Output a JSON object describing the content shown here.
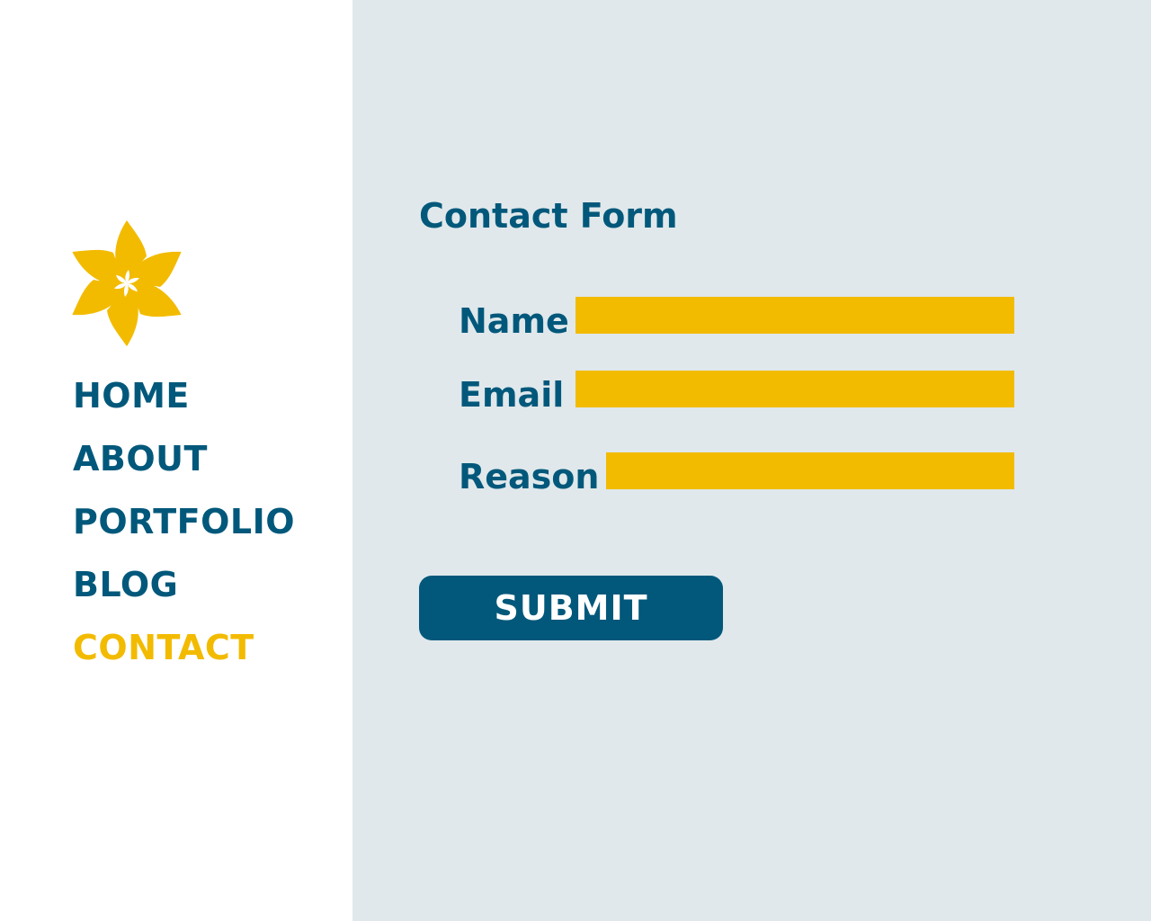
{
  "colors": {
    "brand_blue": "#02587b",
    "accent_yellow": "#f2bb00",
    "main_background": "#e0e8eb",
    "sidebar_background": "#ffffff"
  },
  "logo": {
    "icon": "flower-logo-icon"
  },
  "nav": {
    "items": [
      {
        "label": "HOME",
        "active": false
      },
      {
        "label": "ABOUT",
        "active": false
      },
      {
        "label": "PORTFOLIO",
        "active": false
      },
      {
        "label": "BLOG",
        "active": false
      },
      {
        "label": "CONTACT",
        "active": true
      }
    ]
  },
  "form": {
    "title": "Contact Form",
    "fields": [
      {
        "label": "Name",
        "value": "",
        "placeholder": ""
      },
      {
        "label": "Email",
        "value": "",
        "placeholder": ""
      },
      {
        "label": "Reason",
        "value": "",
        "placeholder": ""
      }
    ],
    "submit_label": "SUBMIT"
  }
}
